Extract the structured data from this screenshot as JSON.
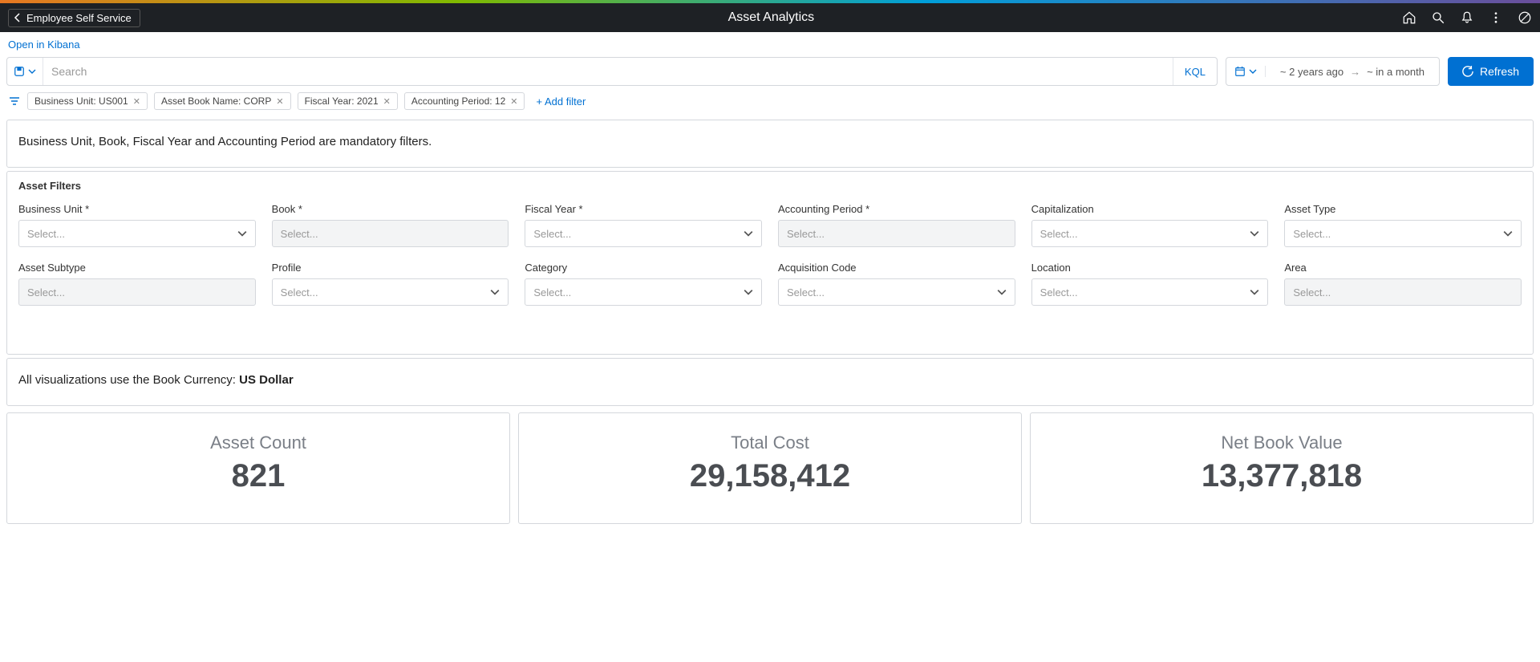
{
  "header": {
    "back_label": "Employee Self Service",
    "title": "Asset Analytics"
  },
  "kibana_link": "Open in Kibana",
  "search": {
    "placeholder": "Search",
    "kql_label": "KQL",
    "date_from": "~ 2 years ago",
    "date_to": "~ in a month",
    "refresh_label": "Refresh"
  },
  "chips": [
    "Business Unit: US001",
    "Asset Book Name: CORP",
    "Fiscal Year: 2021",
    "Accounting Period: 12"
  ],
  "add_filter_label": "+ Add filter",
  "mandatory_text": "Business Unit, Book, Fiscal Year and Accounting Period are mandatory filters.",
  "filters_panel_title": "Asset Filters",
  "filter_fields": [
    {
      "label": "Business Unit *",
      "placeholder": "Select...",
      "has_chevron": true,
      "disabled": false
    },
    {
      "label": "Book *",
      "placeholder": "Select...",
      "has_chevron": false,
      "disabled": true
    },
    {
      "label": "Fiscal Year *",
      "placeholder": "Select...",
      "has_chevron": true,
      "disabled": false
    },
    {
      "label": "Accounting Period *",
      "placeholder": "Select...",
      "has_chevron": false,
      "disabled": true
    },
    {
      "label": "Capitalization",
      "placeholder": "Select...",
      "has_chevron": true,
      "disabled": false
    },
    {
      "label": "Asset Type",
      "placeholder": "Select...",
      "has_chevron": true,
      "disabled": false
    },
    {
      "label": "Asset Subtype",
      "placeholder": "Select...",
      "has_chevron": false,
      "disabled": true
    },
    {
      "label": "Profile",
      "placeholder": "Select...",
      "has_chevron": true,
      "disabled": false
    },
    {
      "label": "Category",
      "placeholder": "Select...",
      "has_chevron": true,
      "disabled": false
    },
    {
      "label": "Acquisition Code",
      "placeholder": "Select...",
      "has_chevron": true,
      "disabled": false
    },
    {
      "label": "Location",
      "placeholder": "Select...",
      "has_chevron": true,
      "disabled": false
    },
    {
      "label": "Area",
      "placeholder": "Select...",
      "has_chevron": false,
      "disabled": true
    }
  ],
  "currency_text": "All visualizations use the Book Currency: ",
  "currency_value": "US Dollar",
  "metrics": [
    {
      "label": "Asset Count",
      "value": "821"
    },
    {
      "label": "Total Cost",
      "value": "29,158,412"
    },
    {
      "label": "Net Book Value",
      "value": "13,377,818"
    }
  ]
}
